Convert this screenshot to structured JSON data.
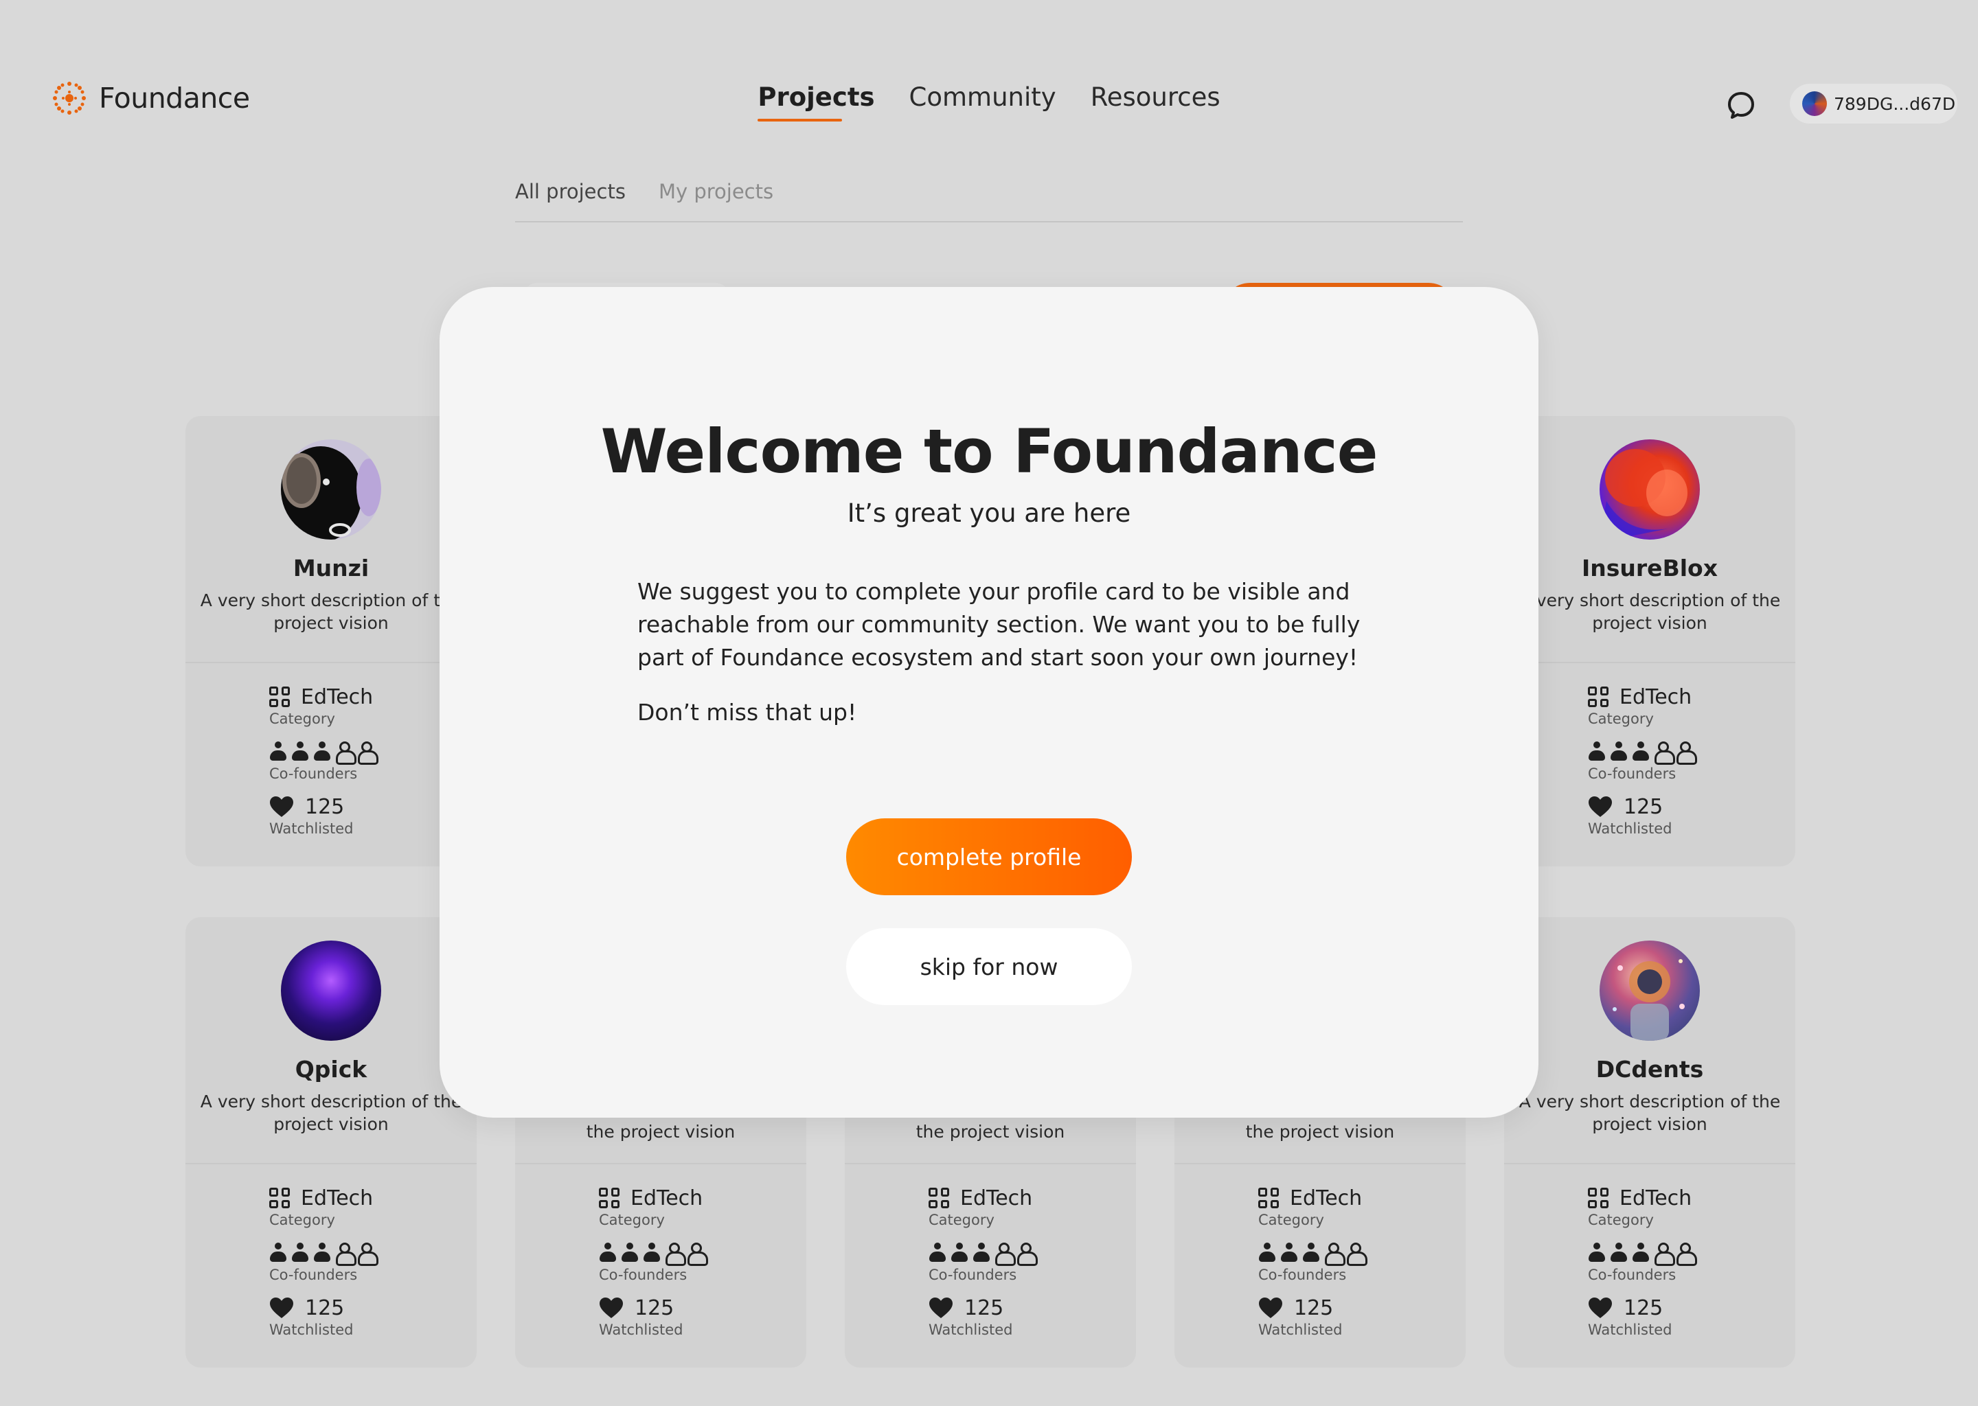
{
  "header": {
    "brand": "Foundance",
    "nav": [
      {
        "label": "Projects",
        "active": true
      },
      {
        "label": "Community",
        "active": false
      },
      {
        "label": "Resources",
        "active": false
      }
    ],
    "wallet": "789DG...d67D"
  },
  "tabs": [
    {
      "label": "All projects",
      "active": true
    },
    {
      "label": "My projects",
      "active": false
    }
  ],
  "cards": [
    {
      "name": "Munzi",
      "desc": "A very short description of the project vision",
      "category": "EdTech",
      "category_label": "Category",
      "cofounders_filled": 3,
      "cofounders_total": 5,
      "cofounders_label": "Co-founders",
      "watchlisted": "125",
      "watchlisted_label": "Watchlisted"
    },
    {
      "name": "InsureBlox",
      "desc": "A very short description of the project vision",
      "category": "EdTech",
      "category_label": "Category",
      "cofounders_filled": 3,
      "cofounders_total": 5,
      "cofounders_label": "Co-founders",
      "watchlisted": "125",
      "watchlisted_label": "Watchlisted"
    },
    {
      "name": "Qpick",
      "desc": "A very short description of the project vision",
      "category": "EdTech",
      "category_label": "Category",
      "cofounders_filled": 3,
      "cofounders_total": 5,
      "cofounders_label": "Co-founders",
      "watchlisted": "125",
      "watchlisted_label": "Watchlisted"
    },
    {
      "name": "",
      "desc": "the project vision",
      "category": "EdTech",
      "category_label": "Category",
      "cofounders_filled": 3,
      "cofounders_total": 5,
      "cofounders_label": "Co-founders",
      "watchlisted": "125",
      "watchlisted_label": "Watchlisted"
    },
    {
      "name": "",
      "desc": "the project vision",
      "category": "EdTech",
      "category_label": "Category",
      "cofounders_filled": 3,
      "cofounders_total": 5,
      "cofounders_label": "Co-founders",
      "watchlisted": "125",
      "watchlisted_label": "Watchlisted"
    },
    {
      "name": "",
      "desc": "the project vision",
      "category": "EdTech",
      "category_label": "Category",
      "cofounders_filled": 3,
      "cofounders_total": 5,
      "cofounders_label": "Co-founders",
      "watchlisted": "125",
      "watchlisted_label": "Watchlisted"
    },
    {
      "name": "DCdents",
      "desc": "A very short description of the project vision",
      "category": "EdTech",
      "category_label": "Category",
      "cofounders_filled": 3,
      "cofounders_total": 5,
      "cofounders_label": "Co-founders",
      "watchlisted": "125",
      "watchlisted_label": "Watchlisted"
    }
  ],
  "modal": {
    "title": "Welcome to Foundance",
    "subtitle": "It’s great you are here",
    "body": "We suggest you to complete your profile card to be visible and reachable from our community section. We want you to be fully part of Foundance ecosystem and start soon your own journey!",
    "note": "Don’t miss that up!",
    "primary_button": "complete profile",
    "secondary_button": "skip for now"
  },
  "colors": {
    "accent": "#e8640f",
    "button_gradient_start": "#ff8a00",
    "button_gradient_end": "#ff5e00",
    "backdrop": "#d9d9d9"
  }
}
